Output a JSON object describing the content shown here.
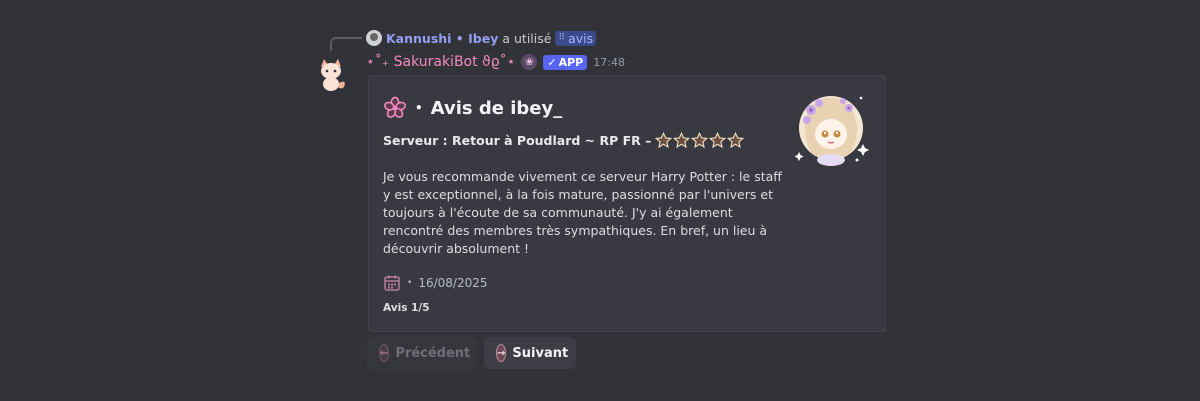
{
  "reply": {
    "user": "Kannushi • Ibey",
    "action": "a utilisé",
    "command": "avis"
  },
  "message": {
    "bot_name": "⋆˚₊ SakurakiBot ϑϱ˚⋆",
    "app_badge": "APP",
    "timestamp": "17:48"
  },
  "embed": {
    "title": "Avis de ibey_",
    "title_sep": "•",
    "server_label": "Serveur : Retour à Poudlard ~ RP FR –",
    "rating": 5,
    "description": "Je vous recommande vivement ce serveur Harry Potter : le staff y est exceptionnel, à la fois mature, passionné par l'univers et toujours à l'écoute de sa communauté. J'y ai également rencontré des membres très sympathiques. En bref, un lieu à découvrir absolument !",
    "date_sep": "•",
    "date": "16/08/2025",
    "footer": "Avis 1/5"
  },
  "buttons": {
    "previous": "Précédent",
    "next": "Suivant"
  },
  "colors": {
    "accent_pink": "#f08ac0",
    "app_badge": "#5865f2",
    "background": "#323339"
  }
}
